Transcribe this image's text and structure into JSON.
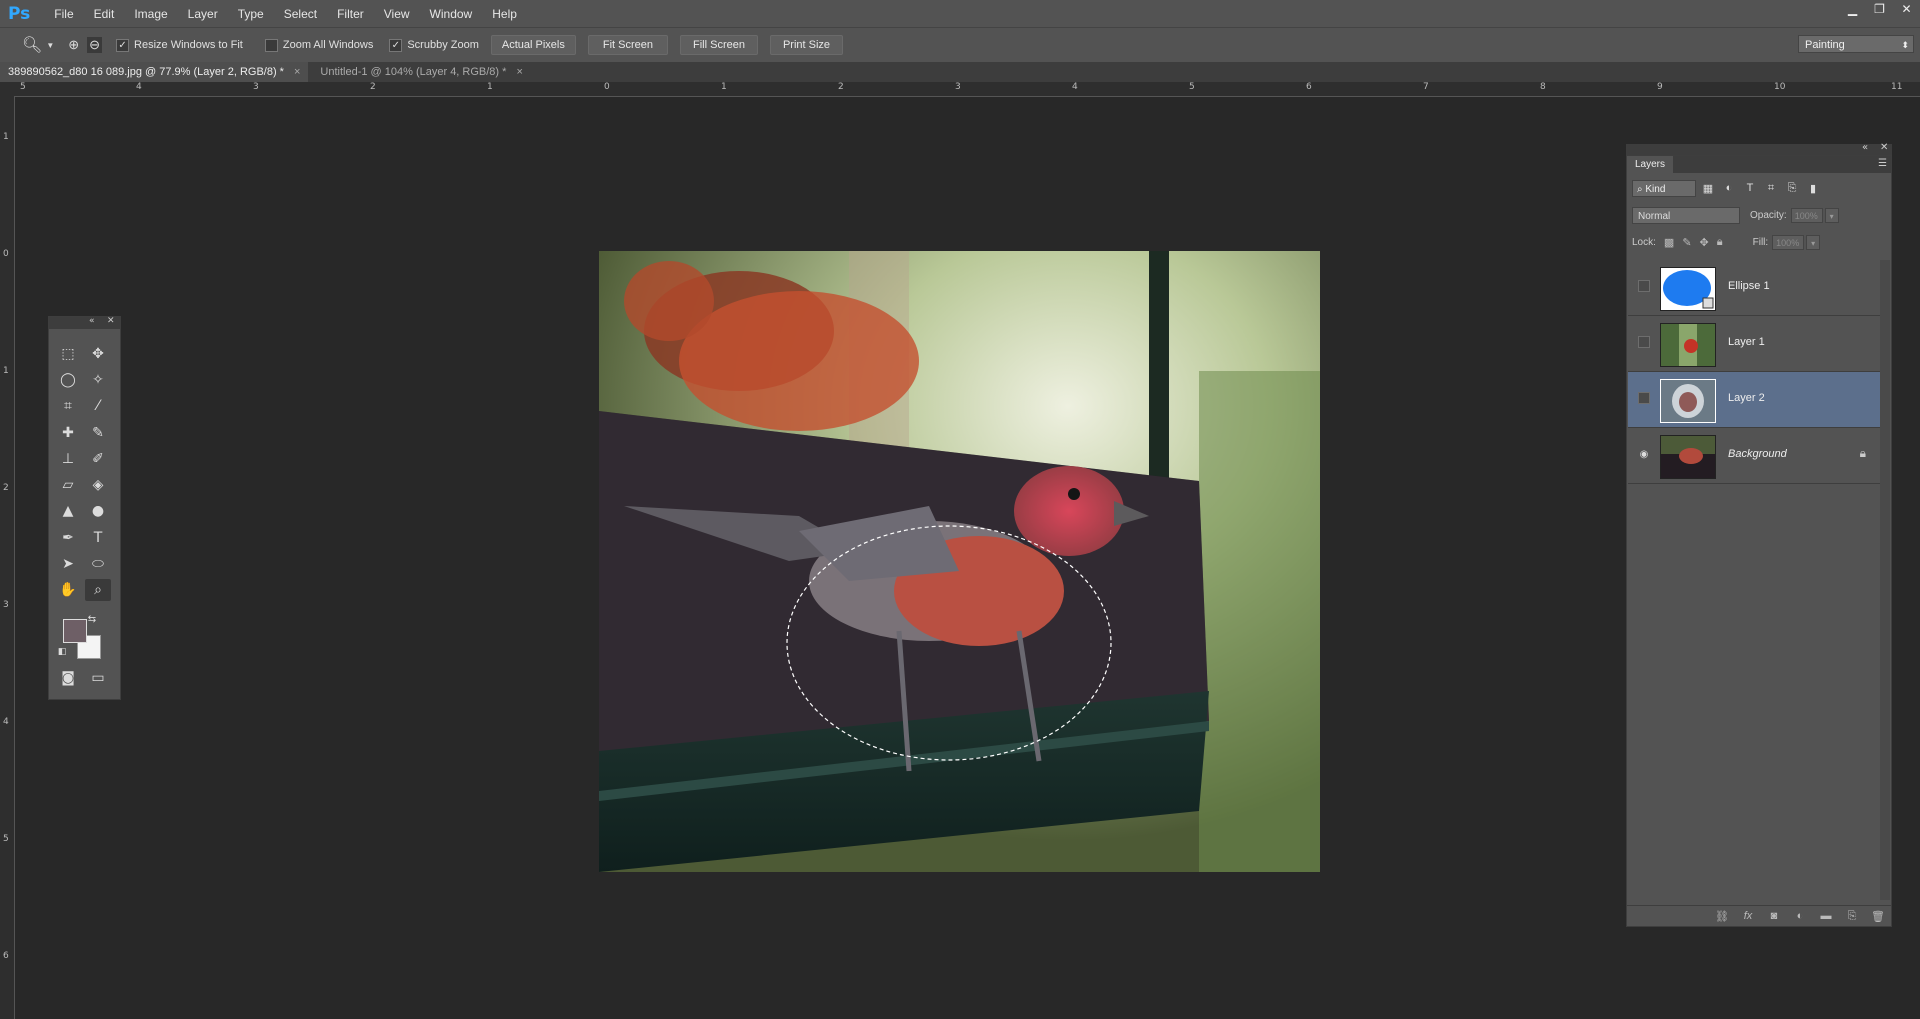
{
  "app": {
    "logo": "Ps"
  },
  "menu": [
    "File",
    "Edit",
    "Image",
    "Layer",
    "Type",
    "Select",
    "Filter",
    "View",
    "Window",
    "Help"
  ],
  "window_controls": {
    "minimize": "▁",
    "restore": "❐",
    "close": "✕"
  },
  "options": {
    "resize_windows": {
      "label": "Resize Windows to Fit",
      "checked": true
    },
    "zoom_all": {
      "label": "Zoom All Windows",
      "checked": false
    },
    "scrubby": {
      "label": "Scrubby Zoom",
      "checked": true
    },
    "buttons": [
      "Actual Pixels",
      "Fit Screen",
      "Fill Screen",
      "Print Size"
    ],
    "workspace": "Painting"
  },
  "tabs": [
    {
      "label": "389890562_d80 16 089.jpg @ 77.9% (Layer 2, RGB/8) *",
      "close": "×"
    },
    {
      "label": "Untitled-1 @ 104% (Layer 4, RGB/8) *",
      "close": "×"
    }
  ],
  "ruler_h": [
    "5",
    "4",
    "3",
    "2",
    "1",
    "0",
    "1",
    "2",
    "3",
    "4",
    "5",
    "6",
    "7",
    "8",
    "9",
    "10",
    "11"
  ],
  "ruler_v": [
    "1",
    "0",
    "1",
    "2",
    "3",
    "4",
    "5",
    "6"
  ],
  "layers_panel": {
    "tab": "Layers",
    "kind": "Kind",
    "blend_mode": "Normal",
    "opacity_label": "Opacity:",
    "opacity_value": "100%",
    "lock_label": "Lock:",
    "fill_label": "Fill:",
    "fill_value": "100%",
    "layers": [
      {
        "name": "Ellipse 1",
        "visible": false,
        "selected": false
      },
      {
        "name": "Layer 1",
        "visible": false,
        "selected": false
      },
      {
        "name": "Layer 2",
        "visible": false,
        "selected": true
      },
      {
        "name": "Background",
        "visible": true,
        "selected": false,
        "locked": true
      }
    ],
    "footer_icons": [
      "link-icon",
      "fx-icon",
      "mask-icon",
      "adjustment-icon",
      "folder-icon",
      "new-layer-icon",
      "trash-icon"
    ]
  },
  "colors": {
    "foreground": "#6e5f66",
    "background": "#f4f4f4",
    "selection": "#5c6f8c",
    "ellipse_thumb": "#1e7bf0"
  }
}
